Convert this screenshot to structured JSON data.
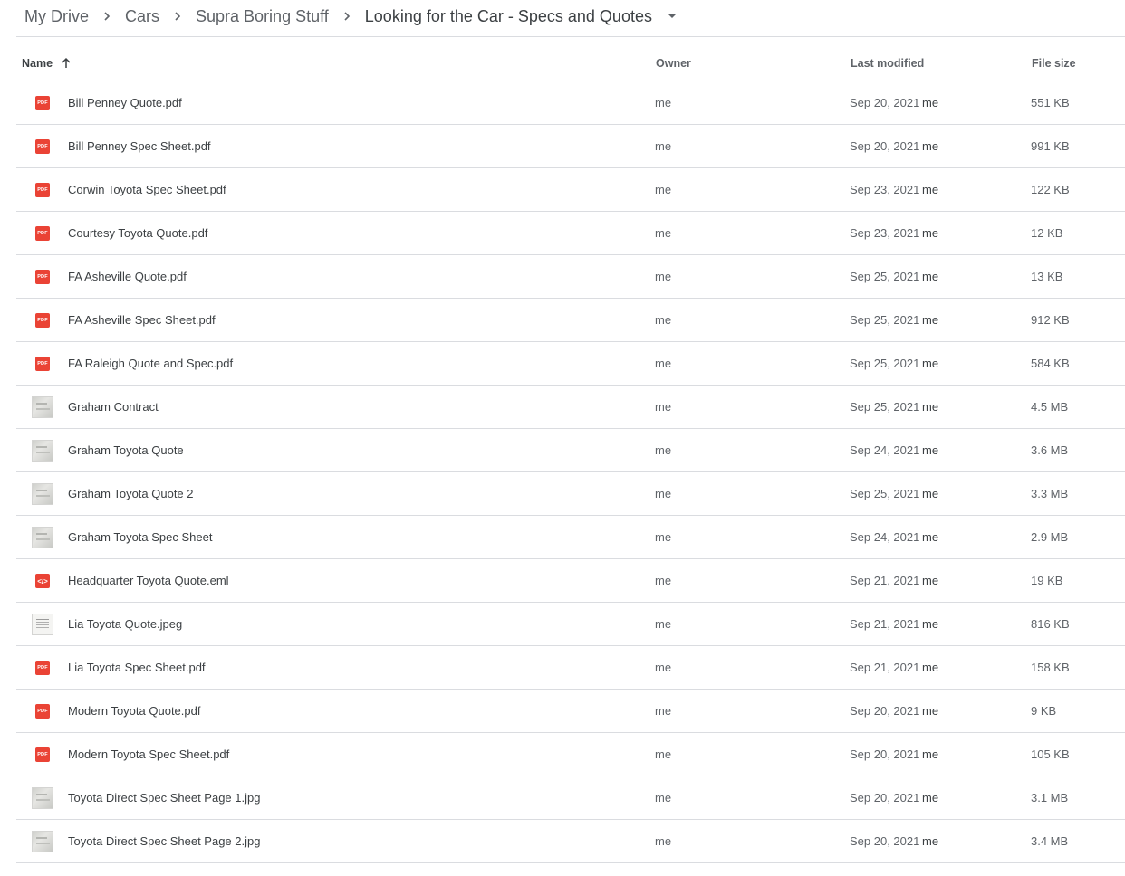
{
  "breadcrumb": {
    "items": [
      "My Drive",
      "Cars",
      "Supra Boring Stuff",
      "Looking for the Car - Specs and Quotes"
    ]
  },
  "columns": {
    "name": "Name",
    "owner": "Owner",
    "modified": "Last modified",
    "size": "File size"
  },
  "icons": {
    "pdf_badge": "PDF",
    "code_badge": "</>",
    "pdf_color": "#ea4335"
  },
  "files": [
    {
      "name": "Bill Penney Quote.pdf",
      "type": "pdf",
      "owner": "me",
      "modified": "Sep 20, 2021",
      "modified_by": "me",
      "size": "551 KB"
    },
    {
      "name": "Bill Penney Spec Sheet.pdf",
      "type": "pdf",
      "owner": "me",
      "modified": "Sep 20, 2021",
      "modified_by": "me",
      "size": "991 KB"
    },
    {
      "name": "Corwin Toyota Spec Sheet.pdf",
      "type": "pdf",
      "owner": "me",
      "modified": "Sep 23, 2021",
      "modified_by": "me",
      "size": "122 KB"
    },
    {
      "name": "Courtesy Toyota Quote.pdf",
      "type": "pdf",
      "owner": "me",
      "modified": "Sep 23, 2021",
      "modified_by": "me",
      "size": "12 KB"
    },
    {
      "name": "FA Asheville Quote.pdf",
      "type": "pdf",
      "owner": "me",
      "modified": "Sep 25, 2021",
      "modified_by": "me",
      "size": "13 KB"
    },
    {
      "name": "FA Asheville Spec Sheet.pdf",
      "type": "pdf",
      "owner": "me",
      "modified": "Sep 25, 2021",
      "modified_by": "me",
      "size": "912 KB"
    },
    {
      "name": "FA Raleigh Quote and Spec.pdf",
      "type": "pdf",
      "owner": "me",
      "modified": "Sep 25, 2021",
      "modified_by": "me",
      "size": "584 KB"
    },
    {
      "name": "Graham Contract",
      "type": "image",
      "owner": "me",
      "modified": "Sep 25, 2021",
      "modified_by": "me",
      "size": "4.5 MB"
    },
    {
      "name": "Graham Toyota Quote",
      "type": "image",
      "owner": "me",
      "modified": "Sep 24, 2021",
      "modified_by": "me",
      "size": "3.6 MB"
    },
    {
      "name": "Graham Toyota Quote 2",
      "type": "image",
      "owner": "me",
      "modified": "Sep 25, 2021",
      "modified_by": "me",
      "size": "3.3 MB"
    },
    {
      "name": "Graham Toyota Spec Sheet",
      "type": "image",
      "owner": "me",
      "modified": "Sep 24, 2021",
      "modified_by": "me",
      "size": "2.9 MB"
    },
    {
      "name": "Headquarter Toyota Quote.eml",
      "type": "code",
      "owner": "me",
      "modified": "Sep 21, 2021",
      "modified_by": "me",
      "size": "19 KB"
    },
    {
      "name": "Lia Toyota Quote.jpeg",
      "type": "doc",
      "owner": "me",
      "modified": "Sep 21, 2021",
      "modified_by": "me",
      "size": "816 KB"
    },
    {
      "name": "Lia Toyota Spec Sheet.pdf",
      "type": "pdf",
      "owner": "me",
      "modified": "Sep 21, 2021",
      "modified_by": "me",
      "size": "158 KB"
    },
    {
      "name": "Modern Toyota Quote.pdf",
      "type": "pdf",
      "owner": "me",
      "modified": "Sep 20, 2021",
      "modified_by": "me",
      "size": "9 KB"
    },
    {
      "name": "Modern Toyota Spec Sheet.pdf",
      "type": "pdf",
      "owner": "me",
      "modified": "Sep 20, 2021",
      "modified_by": "me",
      "size": "105 KB"
    },
    {
      "name": "Toyota Direct Spec Sheet Page 1.jpg",
      "type": "image",
      "owner": "me",
      "modified": "Sep 20, 2021",
      "modified_by": "me",
      "size": "3.1 MB"
    },
    {
      "name": "Toyota Direct Spec Sheet Page 2.jpg",
      "type": "image",
      "owner": "me",
      "modified": "Sep 20, 2021",
      "modified_by": "me",
      "size": "3.4 MB"
    }
  ]
}
